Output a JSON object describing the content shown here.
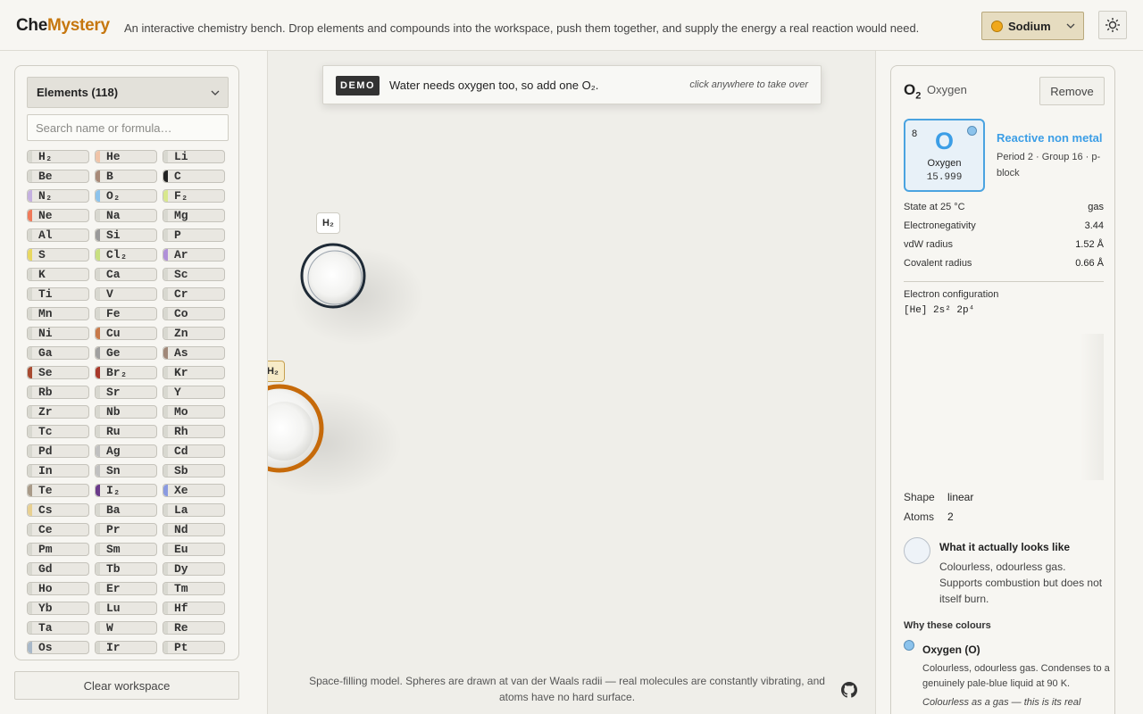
{
  "header": {
    "logo_part1": "Che",
    "logo_part2": "Mystery",
    "tagline": "An interactive chemistry bench. Drop elements and compounds into the workspace, push them together, and supply the energy a real reaction would need.",
    "element_select": {
      "value": "Sodium",
      "color": "#f0a81c"
    },
    "theme_icon": "sun-icon"
  },
  "sidebar": {
    "dropdown_label": "Elements (118)",
    "search_placeholder": "Search name or formula…",
    "chips": [
      {
        "label": "H₂",
        "color": "#d8d8d0"
      },
      {
        "label": "He",
        "color": "#f0c4a8"
      },
      {
        "label": "Li",
        "color": "#d8d8d0"
      },
      {
        "label": "Be",
        "color": "#d8d8d0"
      },
      {
        "label": "B",
        "color": "#a88a78"
      },
      {
        "label": "C",
        "color": "#222222"
      },
      {
        "label": "N₂",
        "color": "#c4b0e0"
      },
      {
        "label": "O₂",
        "color": "#8cc3ec"
      },
      {
        "label": "F₂",
        "color": "#d8e88c"
      },
      {
        "label": "Ne",
        "color": "#f07a5a"
      },
      {
        "label": "Na",
        "color": "#d8d8d0"
      },
      {
        "label": "Mg",
        "color": "#d8d8d0"
      },
      {
        "label": "Al",
        "color": "#d8d8d0"
      },
      {
        "label": "Si",
        "color": "#9a9a9a"
      },
      {
        "label": "P",
        "color": "#d8d8d0"
      },
      {
        "label": "S",
        "color": "#e8d860"
      },
      {
        "label": "Cl₂",
        "color": "#c8e080"
      },
      {
        "label": "Ar",
        "color": "#b090d8"
      },
      {
        "label": "K",
        "color": "#d8d8d0"
      },
      {
        "label": "Ca",
        "color": "#d8d8d0"
      },
      {
        "label": "Sc",
        "color": "#d8d8d0"
      },
      {
        "label": "Ti",
        "color": "#d8d8d0"
      },
      {
        "label": "V",
        "color": "#d8d8d0"
      },
      {
        "label": "Cr",
        "color": "#d8d8d0"
      },
      {
        "label": "Mn",
        "color": "#d8d8d0"
      },
      {
        "label": "Fe",
        "color": "#d8d8d0"
      },
      {
        "label": "Co",
        "color": "#d8d8d0"
      },
      {
        "label": "Ni",
        "color": "#d8d8d0"
      },
      {
        "label": "Cu",
        "color": "#c87a4a"
      },
      {
        "label": "Zn",
        "color": "#d8d8d0"
      },
      {
        "label": "Ga",
        "color": "#d8d8d0"
      },
      {
        "label": "Ge",
        "color": "#a0a0a0"
      },
      {
        "label": "As",
        "color": "#a08878"
      },
      {
        "label": "Se",
        "color": "#a84a30"
      },
      {
        "label": "Br₂",
        "color": "#a8382a"
      },
      {
        "label": "Kr",
        "color": "#d8d8d0"
      },
      {
        "label": "Rb",
        "color": "#d8d8d0"
      },
      {
        "label": "Sr",
        "color": "#d8d8d0"
      },
      {
        "label": "Y",
        "color": "#d8d8d0"
      },
      {
        "label": "Zr",
        "color": "#d8d8d0"
      },
      {
        "label": "Nb",
        "color": "#d8d8d0"
      },
      {
        "label": "Mo",
        "color": "#d8d8d0"
      },
      {
        "label": "Tc",
        "color": "#d8d8d0"
      },
      {
        "label": "Ru",
        "color": "#d8d8d0"
      },
      {
        "label": "Rh",
        "color": "#d8d8d0"
      },
      {
        "label": "Pd",
        "color": "#d8d8d0"
      },
      {
        "label": "Ag",
        "color": "#c0c0c0"
      },
      {
        "label": "Cd",
        "color": "#d8d8d0"
      },
      {
        "label": "In",
        "color": "#d8d8d0"
      },
      {
        "label": "Sn",
        "color": "#c0c0c0"
      },
      {
        "label": "Sb",
        "color": "#d8d8d0"
      },
      {
        "label": "Te",
        "color": "#a89a88"
      },
      {
        "label": "I₂",
        "color": "#6a3a8a"
      },
      {
        "label": "Xe",
        "color": "#8a9ae0"
      },
      {
        "label": "Cs",
        "color": "#e8d090"
      },
      {
        "label": "Ba",
        "color": "#d8d8d0"
      },
      {
        "label": "La",
        "color": "#d8d8d0"
      },
      {
        "label": "Ce",
        "color": "#d8d8d0"
      },
      {
        "label": "Pr",
        "color": "#d8d8d0"
      },
      {
        "label": "Nd",
        "color": "#d8d8d0"
      },
      {
        "label": "Pm",
        "color": "#d8d8d0"
      },
      {
        "label": "Sm",
        "color": "#d8d8d0"
      },
      {
        "label": "Eu",
        "color": "#d8d8d0"
      },
      {
        "label": "Gd",
        "color": "#d8d8d0"
      },
      {
        "label": "Tb",
        "color": "#d8d8d0"
      },
      {
        "label": "Dy",
        "color": "#d8d8d0"
      },
      {
        "label": "Ho",
        "color": "#d8d8d0"
      },
      {
        "label": "Er",
        "color": "#d8d8d0"
      },
      {
        "label": "Tm",
        "color": "#d8d8d0"
      },
      {
        "label": "Yb",
        "color": "#d8d8d0"
      },
      {
        "label": "Lu",
        "color": "#d8d8d0"
      },
      {
        "label": "Hf",
        "color": "#d8d8d0"
      },
      {
        "label": "Ta",
        "color": "#d8d8d0"
      },
      {
        "label": "W",
        "color": "#d8d8d0"
      },
      {
        "label": "Re",
        "color": "#d8d8d0"
      },
      {
        "label": "Os",
        "color": "#a8b8c8"
      },
      {
        "label": "Ir",
        "color": "#d8d8d0"
      },
      {
        "label": "Pt",
        "color": "#d8d8d0"
      }
    ],
    "clear_label": "Clear workspace"
  },
  "workspace": {
    "demo_badge": "DEMO",
    "demo_text": "Water needs oxygen too, so add one O₂.",
    "demo_hint": "click anywhere to take over",
    "molecules": [
      {
        "label": "H₂",
        "ring_color": "#1e2a36",
        "label_bg": "#ffffff",
        "label_border": "#cfcdc4"
      },
      {
        "label": "H₂",
        "ring_color": "#c66a0a",
        "label_bg": "#f7ebc8",
        "label_border": "#c6a050"
      }
    ],
    "caption": "Space-filling model. Spheres are drawn at van der Waals radii — real molecules are constantly vibrating, and atoms have no hard surface.",
    "github_icon": "github-icon"
  },
  "detail": {
    "formula_symbol": "O",
    "formula_sub": "2",
    "name": "Oxygen",
    "remove_label": "Remove",
    "tile": {
      "number": "8",
      "symbol": "O",
      "name": "Oxygen",
      "mass": "15.999",
      "color": "#3c9ee6"
    },
    "category": "Reactive non metal",
    "period_group": "Period 2 · Group 16 · p-block",
    "properties": [
      {
        "label": "State at 25 °C",
        "value": "gas"
      },
      {
        "label": "Electronegativity",
        "value": "3.44"
      },
      {
        "label": "vdW radius",
        "value": "1.52 Å"
      },
      {
        "label": "Covalent radius",
        "value": "0.66 Å"
      }
    ],
    "econf_label": "Electron configuration",
    "econf_value": "[He] 2s² 2p⁴",
    "shape_label": "Shape",
    "shape_value": "linear",
    "atoms_label": "Atoms",
    "atoms_value": "2",
    "look_title": "What it actually looks like",
    "look_desc": "Colourless, odourless gas. Supports combustion but does not itself burn.",
    "why_title": "Why these colours",
    "why_name": "Oxygen (O)",
    "why_desc": "Colourless, odourless gas. Condenses to a genuinely pale-blue liquid at 90 K.",
    "why_note": "Colourless as a gas — this is its real"
  }
}
